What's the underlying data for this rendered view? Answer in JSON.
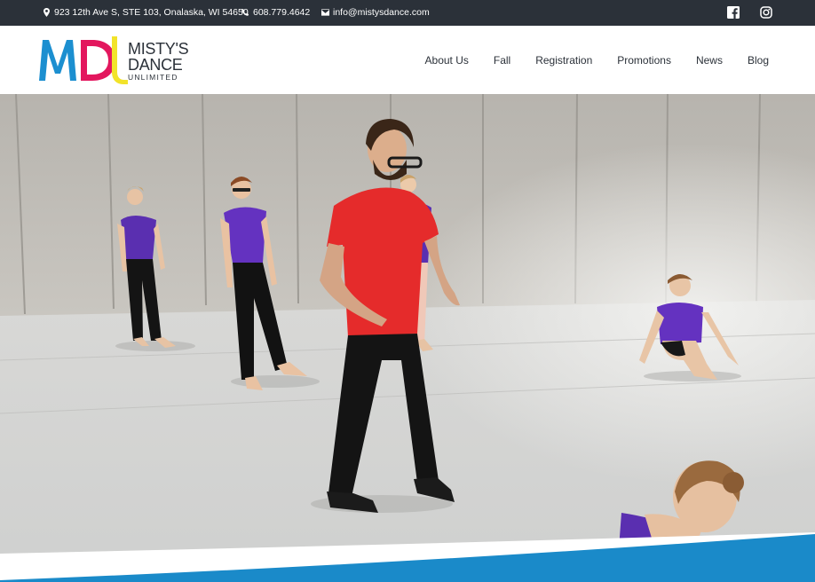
{
  "topbar": {
    "address": "923 12th Ave S, STE 103, Onalaska, WI 54650",
    "phone": "608.779.4642",
    "email": "info@mistysdance.com",
    "social": [
      {
        "icon": "facebook-icon"
      },
      {
        "icon": "instagram-icon"
      }
    ]
  },
  "logo": {
    "mark": "MDU",
    "line1": "MISTY'S",
    "line2": "DANCE",
    "line3": "UNLIMITED"
  },
  "nav": {
    "items": [
      {
        "label": "About Us"
      },
      {
        "label": "Fall"
      },
      {
        "label": "Registration"
      },
      {
        "label": "Promotions"
      },
      {
        "label": "News"
      },
      {
        "label": "Blog"
      }
    ]
  },
  "colors": {
    "topbar_bg": "#2b3139",
    "logo_blue": "#1c8fd0",
    "logo_pink": "#e3175e",
    "logo_yellow": "#f2e32a",
    "accent_blue": "#1a8ac9"
  }
}
